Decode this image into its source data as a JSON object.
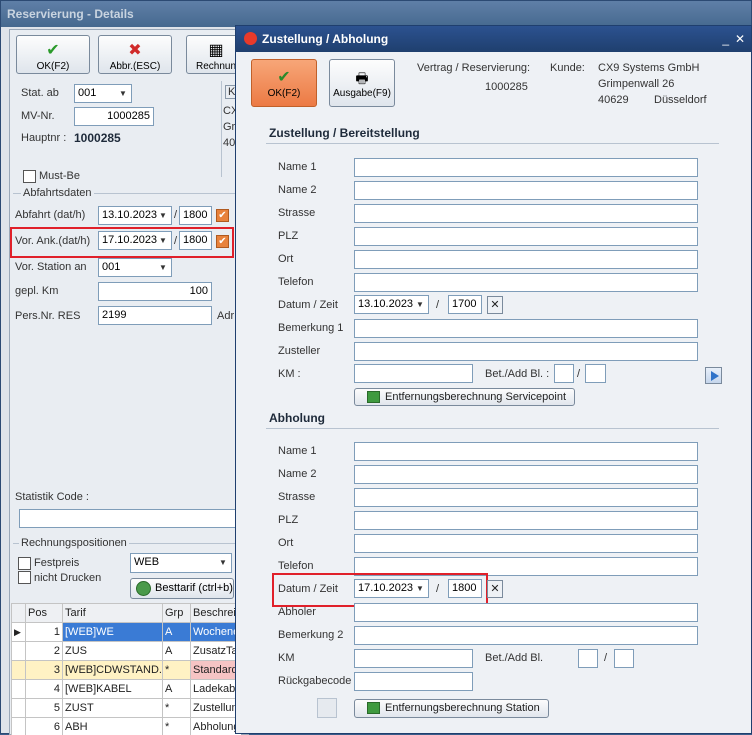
{
  "bg_window": {
    "title": "Reservierung - Details",
    "ok_label": "OK(F2)",
    "cancel_label": "Abbr.(ESC)",
    "invoice_label": "Rechnun",
    "stat_ab_label": "Stat. ab",
    "stat_ab_value": "001",
    "mv_nr_label": "MV-Nr.",
    "mv_nr_value": "1000285",
    "hauptnr_label": "Hauptnr :",
    "hauptnr_value": "1000285",
    "frag_k": "K",
    "frag_c": "CX",
    "frag_g": "Gri",
    "frag_4": "40",
    "must_be_label": "Must-Be",
    "abfahrt_group": "Abfahrtsdaten",
    "abfahrt_label": "Abfahrt (dat/h)",
    "abfahrt_date": "13.10.2023",
    "abfahrt_time": "1800",
    "slash": "/",
    "vor_ank_label": "Vor. Ank.(dat/h)",
    "vor_ank_date": "17.10.2023",
    "vor_ank_time": "1800",
    "vor_station_label": "Vor. Station an",
    "vor_station_value": "001",
    "gepl_km_label": "gepl. Km",
    "gepl_km_value": "100",
    "pers_nr_label": "Pers.Nr. RES",
    "pers_nr_value": "2199",
    "adr_label": "Adr",
    "statistik_label": "Statistik Code :",
    "rechnung_group": "Rechnungspositionen",
    "festpreis_label": "Festpreis",
    "nicht_drucken_label": "nicht Drucken",
    "tarif_select": "WEB",
    "besttarif_label": "Besttarif (ctrl+b)",
    "table": {
      "headers": [
        "Pos",
        "Tarif",
        "Grp",
        "Beschrei"
      ],
      "rows": [
        {
          "pos": "1",
          "tarif": "[WEB]WE",
          "grp": "A",
          "desc": "Wochene"
        },
        {
          "pos": "2",
          "tarif": "ZUS",
          "grp": "A",
          "desc": "ZusatzTa"
        },
        {
          "pos": "3",
          "tarif": "[WEB]CDWSTAND.",
          "grp": "*",
          "desc": "Standard"
        },
        {
          "pos": "4",
          "tarif": "[WEB]KABEL",
          "grp": "A",
          "desc": "Ladekab"
        },
        {
          "pos": "5",
          "tarif": "ZUST",
          "grp": "*",
          "desc": "Zustellun"
        },
        {
          "pos": "6",
          "tarif": "ABH",
          "grp": "*",
          "desc": "Abholung"
        }
      ]
    }
  },
  "dialog": {
    "title": "Zustellung / Abholung",
    "ok_label": "OK(F2)",
    "print_label": "Ausgabe(F9)",
    "vertrag_label": "Vertrag / Reservierung:",
    "vertrag_value": "1000285",
    "kunde_label": "Kunde:",
    "kunde_name": "CX9 Systems GmbH",
    "kunde_street": "Grimpenwall 26",
    "kunde_zip": "40629",
    "kunde_city": "Düsseldorf",
    "zustellung": {
      "heading": "Zustellung / Bereitstellung",
      "name1": "Name 1",
      "name2": "Name 2",
      "strasse": "Strasse",
      "plz": "PLZ",
      "ort": "Ort",
      "telefon": "Telefon",
      "datum_label": "Datum / Zeit",
      "datum_value": "13.10.2023",
      "zeit_value": "1700",
      "bemerkung": "Bemerkung 1",
      "zusteller": "Zusteller",
      "km_label": "KM :",
      "bet_label": "Bet./Add Bl. :",
      "button": "Entfernungsberechnung Servicepoint"
    },
    "abholung": {
      "heading": "Abholung",
      "name1": "Name 1",
      "name2": "Name 2",
      "strasse": "Strasse",
      "plz": "PLZ",
      "ort": "Ort",
      "telefon": "Telefon",
      "datum_label": "Datum / Zeit",
      "datum_value": "17.10.2023",
      "zeit_value": "1800",
      "abholer": "Abholer",
      "bemerkung": "Bemerkung 2",
      "km_label": "KM",
      "bet_label": "Bet./Add Bl.",
      "rueckgabe": "Rückgabecode",
      "button": "Entfernungsberechnung Station"
    }
  },
  "colors": {
    "highlight": "#e0202a",
    "title_bar": "#1f3f6e",
    "ok_button": "#f08a55",
    "selected_row": "#3a7bd5"
  }
}
